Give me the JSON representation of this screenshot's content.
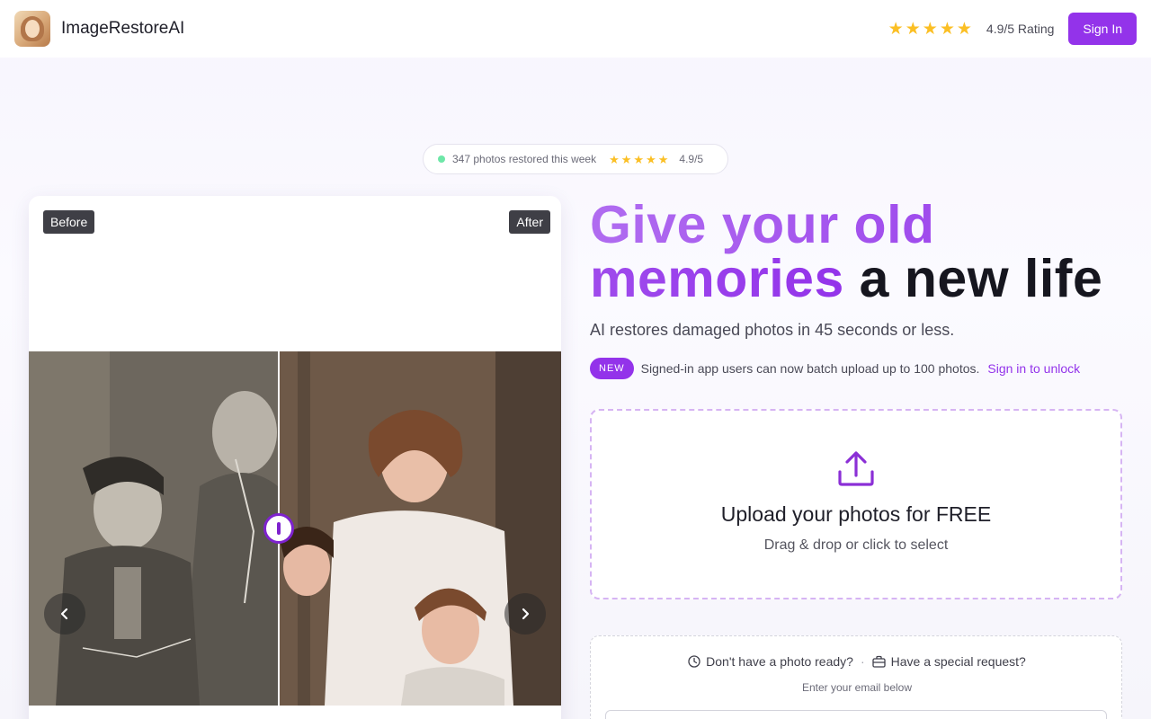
{
  "header": {
    "brand_name": "ImageRestoreAI",
    "rating_stars": 5,
    "rating_text": "4.9/5 Rating",
    "signin_label": "Sign In"
  },
  "proof": {
    "restored_text": "347 photos restored this week",
    "stars": 5,
    "score": "4.9/5"
  },
  "compare": {
    "before_label": "Before",
    "after_label": "After",
    "slider_position": 0.47
  },
  "hero": {
    "title_gradient": "Give your old memories",
    "title_dark": "a new life",
    "subtitle": "AI restores damaged photos in 45 seconds or less.",
    "new_badge": "NEW",
    "new_text": "Signed-in app users can now batch upload up to 100 photos.",
    "unlock_link": "Sign in to unlock"
  },
  "upload": {
    "icon": "upload-icon",
    "title": "Upload your photos for FREE",
    "subtitle": "Drag & drop or click to select"
  },
  "request": {
    "no_photo": "Don't have a photo ready?",
    "separator": "·",
    "special_request": "Have a special request?",
    "hint": "Enter your email below",
    "email_placeholder": ""
  },
  "colors": {
    "accent": "#9333ea",
    "star": "#fbbf24",
    "dashed_border": "#d6b4f3"
  }
}
